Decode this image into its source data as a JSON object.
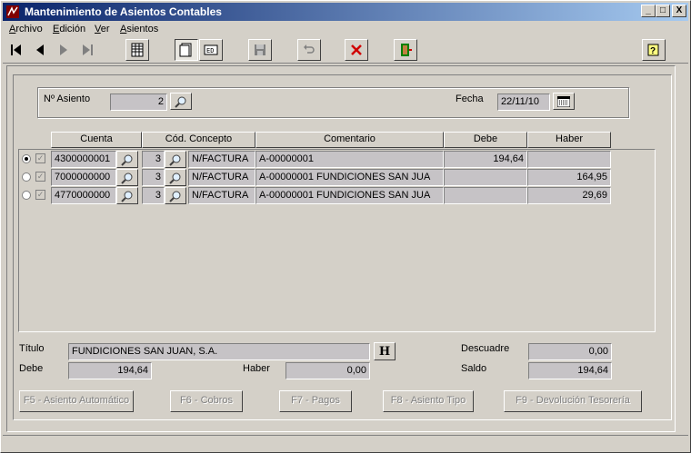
{
  "window": {
    "title": "Mantenimiento de Asientos Contables",
    "min": "_",
    "max": "□",
    "close": "X"
  },
  "menu": [
    {
      "label": "Archivo"
    },
    {
      "label": "Edición"
    },
    {
      "label": "Ver"
    },
    {
      "label": "Asientos"
    }
  ],
  "header": {
    "asiento_label": "Nº Asiento",
    "asiento_value": "2",
    "fecha_label": "Fecha",
    "fecha_value": "22/11/10"
  },
  "columns": [
    "Cuenta",
    "Cód. Concepto",
    "Comentario",
    "Debe",
    "Haber"
  ],
  "rows": [
    {
      "selected": true,
      "cuenta": "4300000001",
      "cod": "3",
      "concepto": "N/FACTURA",
      "comentario": "A-00000001",
      "debe": "194,64",
      "haber": ""
    },
    {
      "selected": false,
      "cuenta": "7000000000",
      "cod": "3",
      "concepto": "N/FACTURA",
      "comentario": "A-00000001 FUNDICIONES SAN JUA",
      "debe": "",
      "haber": "164,95"
    },
    {
      "selected": false,
      "cuenta": "4770000000",
      "cod": "3",
      "concepto": "N/FACTURA",
      "comentario": "A-00000001 FUNDICIONES SAN JUA",
      "debe": "",
      "haber": "29,69"
    }
  ],
  "footer": {
    "titulo_label": "Título",
    "titulo_value": "FUNDICIONES SAN JUAN, S.A.",
    "h_button": "H",
    "descuadre_label": "Descuadre",
    "descuadre_value": "0,00",
    "debe_label": "Debe",
    "debe_value": "194,64",
    "haber_label": "Haber",
    "haber_value": "0,00",
    "saldo_label": "Saldo",
    "saldo_value": "194,64"
  },
  "fbuttons": [
    "F5 - Asiento Automático",
    "F6 - Cobros",
    "F7 - Pagos",
    "F8 - Asiento Tipo",
    "F9 - Devolución Tesorería"
  ],
  "colors": {
    "title_start": "#0a246a",
    "title_end": "#a6caf0",
    "face": "#d4d0c8",
    "field": "#c6c3c6"
  }
}
